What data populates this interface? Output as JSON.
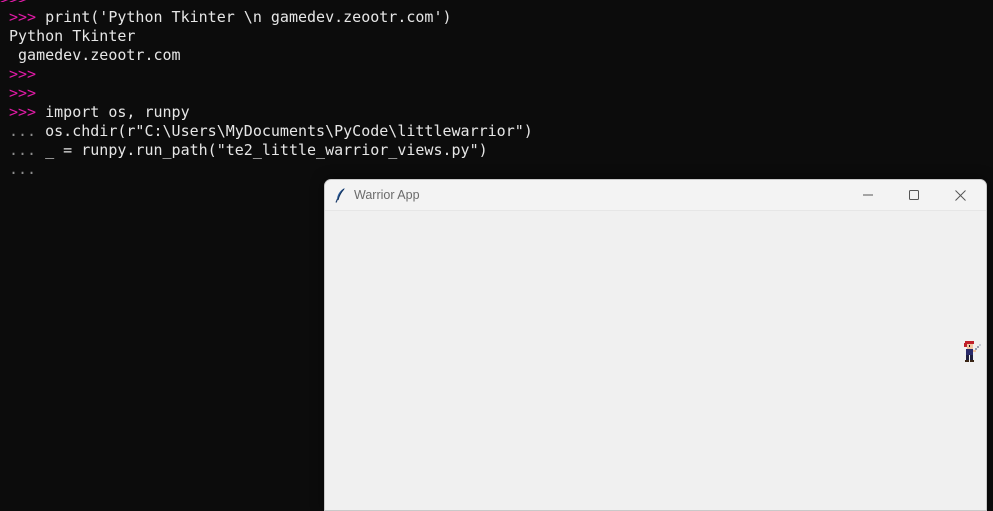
{
  "terminal": {
    "lines": [
      {
        "prompt": ">>>",
        "text": " print('Python Tkinter \\n gamedev.zeootr.com')"
      },
      {
        "prompt": "",
        "text": "Python Tkinter"
      },
      {
        "prompt": "",
        "text": " gamedev.zeootr.com"
      },
      {
        "prompt": ">>>",
        "text": ""
      },
      {
        "prompt": ">>>",
        "text": ""
      },
      {
        "prompt": ">>>",
        "text": " import os, runpy"
      },
      {
        "prompt": "...",
        "text": " os.chdir(r\"C:\\Users\\MyDocuments\\PyCode\\littlewarrior\")"
      },
      {
        "prompt": "...",
        "text": " _ = runpy.run_path(\"te2_little_warrior_views.py\")"
      },
      {
        "prompt": "...",
        "text": ""
      }
    ],
    "top_edge_prompt": ">>>",
    "colors": {
      "background": "#0c0c0c",
      "prompt": "#e01ba6",
      "continuation": "#8e8e8e",
      "text": "#e6e6e6"
    }
  },
  "window": {
    "title": "Warrior App",
    "icon": "tk-feather-icon",
    "controls": [
      "minimize-icon",
      "maximize-icon",
      "close-icon"
    ],
    "canvas_background": "#f0f0f0",
    "sprite": "warrior-sprite-icon"
  }
}
